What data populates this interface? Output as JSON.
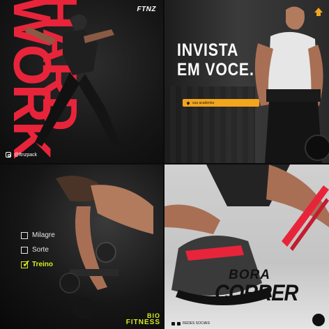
{
  "panels": {
    "p1": {
      "logo": "FTNZ",
      "big_text_red_1": "WORK",
      "big_text_red_2": "HARD",
      "handle": "@ftnzpack",
      "accent": "#e8243b"
    },
    "p2": {
      "headline_line1": "INVISTA",
      "headline_line2": "EM VOCE.",
      "cta_label": "sua academia",
      "accent": "#f2a51d"
    },
    "p3": {
      "options": [
        {
          "label": "Milagre",
          "checked": false
        },
        {
          "label": "Sorte",
          "checked": false
        },
        {
          "label": "Treino",
          "checked": true
        }
      ],
      "brand_line1": "BIO",
      "brand_line2": "FITNESS",
      "accent": "#d8ec20"
    },
    "p4": {
      "title_line1": "BORA",
      "title_line2": "CORRER",
      "social_label": "REDES SOCIAIS",
      "accent": "#e8243b"
    }
  },
  "icons": {
    "p1_handle": "instagram-icon",
    "p2_cta": "location-pin-icon",
    "p3_check": "check-icon",
    "p4_social": [
      "facebook-icon",
      "instagram-icon"
    ]
  }
}
